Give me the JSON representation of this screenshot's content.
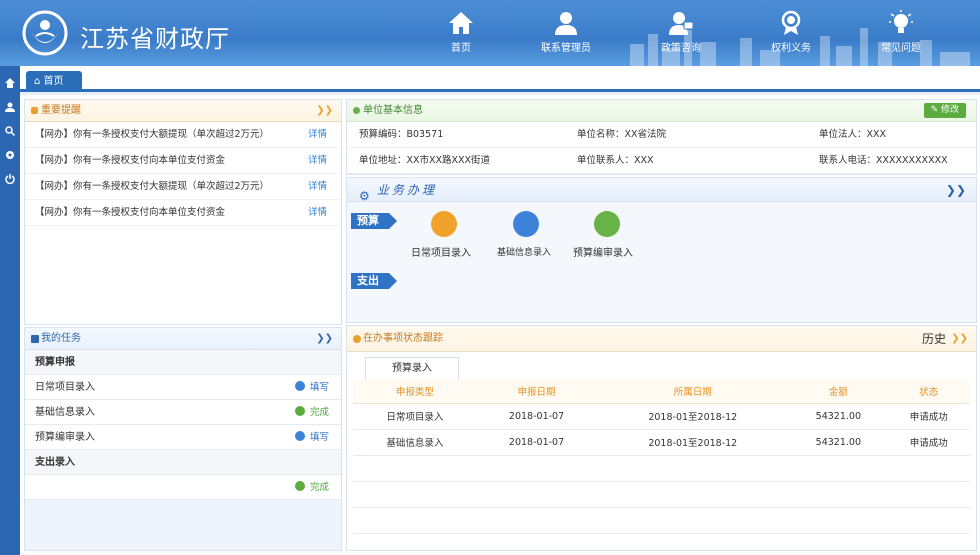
{
  "header": {
    "title": "江苏省财政厅",
    "nav": [
      {
        "label": "首页",
        "icon": "home-icon"
      },
      {
        "label": "联系管理员",
        "icon": "user-icon"
      },
      {
        "label": "政策咨询",
        "icon": "consult-icon"
      },
      {
        "label": "权利义务",
        "icon": "medal-icon"
      },
      {
        "label": "常见问题",
        "icon": "lightbulb-icon"
      }
    ]
  },
  "sidebar": {
    "icons": [
      "home-icon",
      "user-icon",
      "search-icon",
      "gear-icon",
      "power-icon"
    ]
  },
  "tabs": {
    "home": "首页"
  },
  "reminders": {
    "title": "重要提醒",
    "items": [
      {
        "text": "【网办】你有一条授权支付大额提现（单次超过2万元）",
        "link": "详情"
      },
      {
        "text": "【网办】你有一条授权支付向本单位支付资金",
        "link": "详情"
      },
      {
        "text": "【网办】你有一条授权支付大额提现（单次超过2万元）",
        "link": "详情"
      },
      {
        "text": "【网办】你有一条授权支付向本单位支付资金",
        "link": "详情"
      }
    ]
  },
  "tasks": {
    "title": "我的任务",
    "groups": [
      {
        "label": "预算申报"
      },
      {
        "label": "日常项目录入",
        "action": "填写"
      },
      {
        "label": "基础信息录入",
        "action": "完成"
      },
      {
        "label": "预算编审录入",
        "action": "填写"
      },
      {
        "label": "支出录入"
      },
      {
        "label": "",
        "action": "完成"
      }
    ]
  },
  "unit": {
    "title": "单位基本信息",
    "edit": "修改",
    "budget_code": "预算编码：B03571",
    "name": "单位名称：XX省法院",
    "legal": "单位法人：XXX",
    "address": "单位地址：XX市XX路XXX街道",
    "contact": "单位联系人：XXX",
    "phone": "联系人电话：XXXXXXXXXXX"
  },
  "business": {
    "title": "业务办理",
    "budget_tag": "预算",
    "expense_tag": "支出",
    "items": [
      {
        "label": "日常项目录入",
        "color": "#f0a22c"
      },
      {
        "label": "基础信息录入",
        "color": "#3b82d8"
      },
      {
        "label": "预算编审录入",
        "color": "#67b347"
      }
    ]
  },
  "tracking": {
    "title": "在办事项状态跟踪",
    "history": "历史",
    "subtab": "预算录入",
    "columns": [
      "申报类型",
      "申报日期",
      "所属日期",
      "金额",
      "状态"
    ],
    "rows": [
      [
        "日常项目录入",
        "2018-01-07",
        "2018-01至2018-12",
        "54321.00",
        "申请成功"
      ],
      [
        "基础信息录入",
        "2018-01-07",
        "2018-01至2018-12",
        "54321.00",
        "申请成功"
      ]
    ]
  },
  "colors": {
    "brand": "#3b7cc9",
    "accent_orange": "#e8a02d",
    "accent_green": "#5cab3f",
    "link_blue": "#2e7ed7"
  }
}
